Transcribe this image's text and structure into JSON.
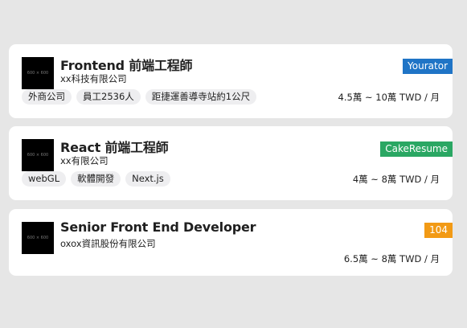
{
  "jobs": [
    {
      "title": "Frontend 前端工程師",
      "company": "xx科技有限公司",
      "logo_text": "600 × 600",
      "source": "Yourator",
      "source_color": "#1f74c6",
      "tags": [
        "外商公司",
        "員工2536人",
        "距捷運善導寺站約1公尺"
      ],
      "salary": "4.5萬 ~ 10萬 TWD / 月"
    },
    {
      "title": "React 前端工程師",
      "company": "xx有限公司",
      "logo_text": "600 × 600",
      "source": "CakeResume",
      "source_color": "#2aa763",
      "tags": [
        "webGL",
        "軟體開發",
        "Next.js"
      ],
      "salary": "4萬 ~ 8萬 TWD / 月"
    },
    {
      "title": "Senior Front End Developer",
      "company": "oxox資訊股份有限公司",
      "logo_text": "600 × 600",
      "source": "104",
      "source_color": "#f29a15",
      "tags": [],
      "salary": "6.5萬 ~ 8萬 TWD / 月"
    }
  ]
}
